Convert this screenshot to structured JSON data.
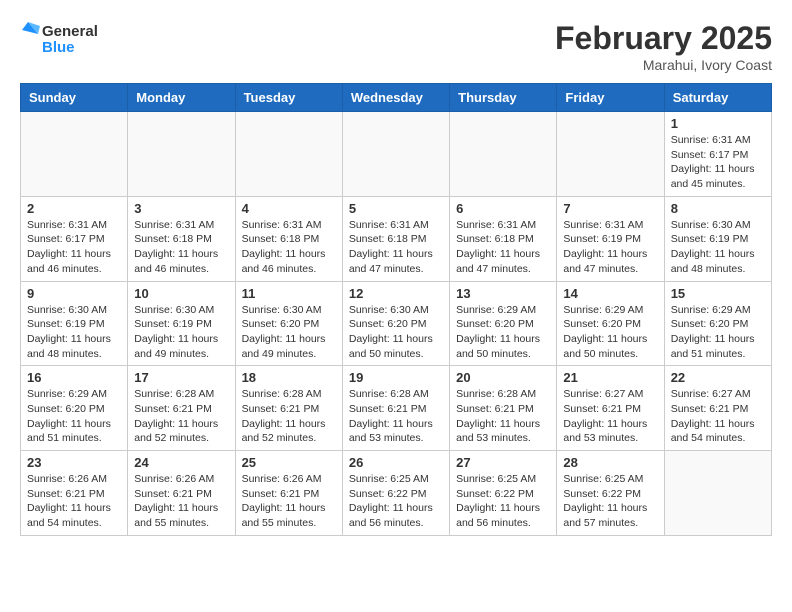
{
  "header": {
    "logo_general": "General",
    "logo_blue": "Blue",
    "month_title": "February 2025",
    "subtitle": "Marahui, Ivory Coast"
  },
  "weekdays": [
    "Sunday",
    "Monday",
    "Tuesday",
    "Wednesday",
    "Thursday",
    "Friday",
    "Saturday"
  ],
  "weeks": [
    [
      {
        "day": "",
        "info": ""
      },
      {
        "day": "",
        "info": ""
      },
      {
        "day": "",
        "info": ""
      },
      {
        "day": "",
        "info": ""
      },
      {
        "day": "",
        "info": ""
      },
      {
        "day": "",
        "info": ""
      },
      {
        "day": "1",
        "info": "Sunrise: 6:31 AM\nSunset: 6:17 PM\nDaylight: 11 hours\nand 45 minutes."
      }
    ],
    [
      {
        "day": "2",
        "info": "Sunrise: 6:31 AM\nSunset: 6:17 PM\nDaylight: 11 hours\nand 46 minutes."
      },
      {
        "day": "3",
        "info": "Sunrise: 6:31 AM\nSunset: 6:18 PM\nDaylight: 11 hours\nand 46 minutes."
      },
      {
        "day": "4",
        "info": "Sunrise: 6:31 AM\nSunset: 6:18 PM\nDaylight: 11 hours\nand 46 minutes."
      },
      {
        "day": "5",
        "info": "Sunrise: 6:31 AM\nSunset: 6:18 PM\nDaylight: 11 hours\nand 47 minutes."
      },
      {
        "day": "6",
        "info": "Sunrise: 6:31 AM\nSunset: 6:18 PM\nDaylight: 11 hours\nand 47 minutes."
      },
      {
        "day": "7",
        "info": "Sunrise: 6:31 AM\nSunset: 6:19 PM\nDaylight: 11 hours\nand 47 minutes."
      },
      {
        "day": "8",
        "info": "Sunrise: 6:30 AM\nSunset: 6:19 PM\nDaylight: 11 hours\nand 48 minutes."
      }
    ],
    [
      {
        "day": "9",
        "info": "Sunrise: 6:30 AM\nSunset: 6:19 PM\nDaylight: 11 hours\nand 48 minutes."
      },
      {
        "day": "10",
        "info": "Sunrise: 6:30 AM\nSunset: 6:19 PM\nDaylight: 11 hours\nand 49 minutes."
      },
      {
        "day": "11",
        "info": "Sunrise: 6:30 AM\nSunset: 6:20 PM\nDaylight: 11 hours\nand 49 minutes."
      },
      {
        "day": "12",
        "info": "Sunrise: 6:30 AM\nSunset: 6:20 PM\nDaylight: 11 hours\nand 50 minutes."
      },
      {
        "day": "13",
        "info": "Sunrise: 6:29 AM\nSunset: 6:20 PM\nDaylight: 11 hours\nand 50 minutes."
      },
      {
        "day": "14",
        "info": "Sunrise: 6:29 AM\nSunset: 6:20 PM\nDaylight: 11 hours\nand 50 minutes."
      },
      {
        "day": "15",
        "info": "Sunrise: 6:29 AM\nSunset: 6:20 PM\nDaylight: 11 hours\nand 51 minutes."
      }
    ],
    [
      {
        "day": "16",
        "info": "Sunrise: 6:29 AM\nSunset: 6:20 PM\nDaylight: 11 hours\nand 51 minutes."
      },
      {
        "day": "17",
        "info": "Sunrise: 6:28 AM\nSunset: 6:21 PM\nDaylight: 11 hours\nand 52 minutes."
      },
      {
        "day": "18",
        "info": "Sunrise: 6:28 AM\nSunset: 6:21 PM\nDaylight: 11 hours\nand 52 minutes."
      },
      {
        "day": "19",
        "info": "Sunrise: 6:28 AM\nSunset: 6:21 PM\nDaylight: 11 hours\nand 53 minutes."
      },
      {
        "day": "20",
        "info": "Sunrise: 6:28 AM\nSunset: 6:21 PM\nDaylight: 11 hours\nand 53 minutes."
      },
      {
        "day": "21",
        "info": "Sunrise: 6:27 AM\nSunset: 6:21 PM\nDaylight: 11 hours\nand 53 minutes."
      },
      {
        "day": "22",
        "info": "Sunrise: 6:27 AM\nSunset: 6:21 PM\nDaylight: 11 hours\nand 54 minutes."
      }
    ],
    [
      {
        "day": "23",
        "info": "Sunrise: 6:26 AM\nSunset: 6:21 PM\nDaylight: 11 hours\nand 54 minutes."
      },
      {
        "day": "24",
        "info": "Sunrise: 6:26 AM\nSunset: 6:21 PM\nDaylight: 11 hours\nand 55 minutes."
      },
      {
        "day": "25",
        "info": "Sunrise: 6:26 AM\nSunset: 6:21 PM\nDaylight: 11 hours\nand 55 minutes."
      },
      {
        "day": "26",
        "info": "Sunrise: 6:25 AM\nSunset: 6:22 PM\nDaylight: 11 hours\nand 56 minutes."
      },
      {
        "day": "27",
        "info": "Sunrise: 6:25 AM\nSunset: 6:22 PM\nDaylight: 11 hours\nand 56 minutes."
      },
      {
        "day": "28",
        "info": "Sunrise: 6:25 AM\nSunset: 6:22 PM\nDaylight: 11 hours\nand 57 minutes."
      },
      {
        "day": "",
        "info": ""
      }
    ]
  ]
}
